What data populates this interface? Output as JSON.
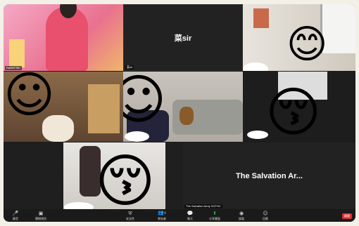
{
  "meeting": {
    "tiles": [
      {
        "id": "tile-1",
        "name_tag": "Rachel Wu"
      },
      {
        "id": "tile-2",
        "display_name": "菜sir",
        "name_tag": "菜sir"
      },
      {
        "id": "tile-3",
        "name_tag": ""
      },
      {
        "id": "tile-4",
        "name_tag": ""
      },
      {
        "id": "tile-5",
        "name_tag": ""
      },
      {
        "id": "tile-6",
        "name_tag": ""
      },
      {
        "id": "tile-7",
        "name_tag": ""
      },
      {
        "id": "tile-8",
        "display_name": "The Salvation Ar...",
        "name_tag": "The Salvation Army SCFHC"
      }
    ]
  },
  "toolbar": {
    "mute": "靜音",
    "video": "關閉視訊",
    "security": "安全性",
    "participants": "參加者",
    "participants_count": "9",
    "chat": "聊天",
    "share": "分享畫面",
    "record": "錄製",
    "reactions": "回應",
    "leave": "離開"
  },
  "icons": {
    "mute": "mic-icon",
    "video": "camera-icon",
    "security": "shield-icon",
    "participants": "people-icon",
    "chat": "chat-icon",
    "share": "share-screen-icon",
    "record": "record-icon",
    "reactions": "smile-icon"
  },
  "colors": {
    "share_accent": "#2db34a",
    "leave_red": "#d33333",
    "emoji_yellow": "#f7c531"
  }
}
